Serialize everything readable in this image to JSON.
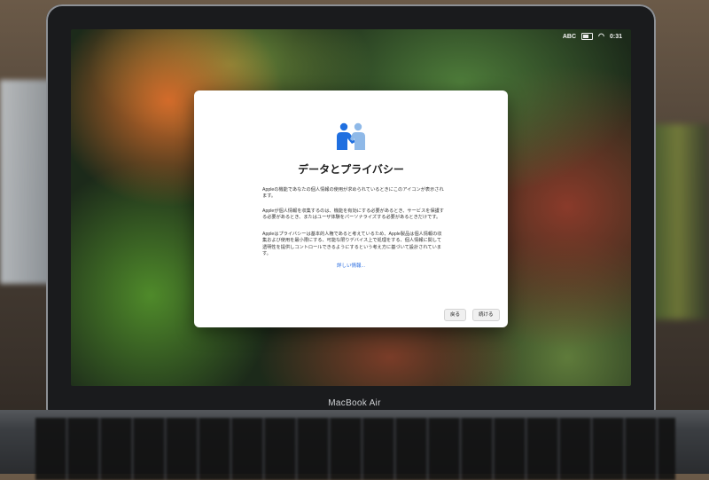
{
  "menubar": {
    "input_source": "ABC",
    "time": "0:31",
    "icons": [
      "battery-icon",
      "wifi-icon"
    ]
  },
  "dialog": {
    "icon": "handshake-icon",
    "title": "データとプライバシー",
    "paragraphs": [
      "Appleの機能であなたの個人情報の使用が求められているときにこのアイコンが表示されます。",
      "Appleが個人情報を収集するのは、機能を有効にする必要があるとき、サービスを保護する必要があるとき、またはユーザ体験をパーソナライズする必要があるときだけです。",
      "Appleはプライバシーは基本的人権であると考えているため、Apple製品は個人情報の収集および使用を最小限にする、可能な限りデバイス上で処理をする、個人情報に関して透明性を提供しコントロールできるようにするという考え方に基づいて設計されています。"
    ],
    "learn_more": "詳しい情報...",
    "back_label": "戻る",
    "continue_label": "続ける"
  },
  "device": {
    "model_label": "MacBook Air"
  }
}
